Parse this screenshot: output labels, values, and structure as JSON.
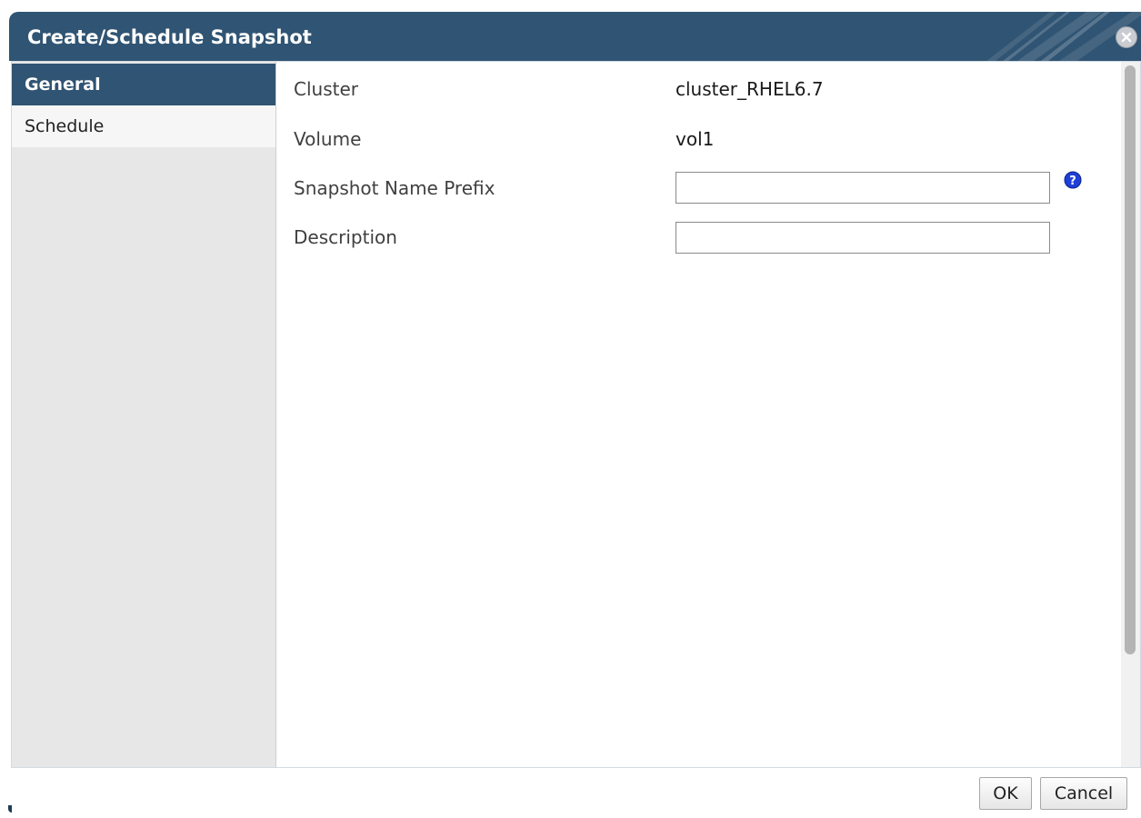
{
  "dialog": {
    "title": "Create/Schedule Snapshot"
  },
  "sidebar": {
    "items": [
      {
        "label": "General",
        "active": true
      },
      {
        "label": "Schedule",
        "active": false
      }
    ]
  },
  "form": {
    "cluster_label": "Cluster",
    "cluster_value": "cluster_RHEL6.7",
    "volume_label": "Volume",
    "volume_value": "vol1",
    "prefix_label": "Snapshot Name Prefix",
    "prefix_value": "",
    "description_label": "Description",
    "description_value": ""
  },
  "footer": {
    "ok_label": "OK",
    "cancel_label": "Cancel"
  },
  "colors": {
    "header_bg": "#305473",
    "help_icon": "#1f3fd6",
    "sidebar_bg": "#e7e7e7"
  },
  "icons": {
    "close": "close-icon",
    "help": "help-icon"
  }
}
